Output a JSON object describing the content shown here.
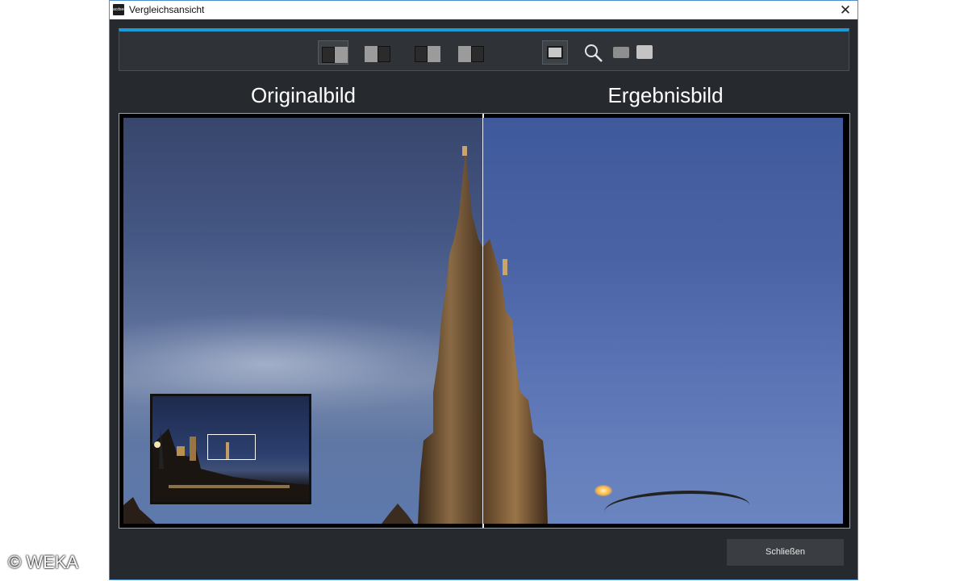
{
  "window": {
    "title": "Vergleichsansicht",
    "app_icon_text": "acdsee",
    "close_glyph": "✕"
  },
  "toolbar": {
    "accent_color": "#1c9ad6",
    "buttons": [
      {
        "icon": "split-view-vertical-icon",
        "active": true
      },
      {
        "icon": "split-view-left-icon",
        "active": false
      },
      {
        "icon": "side-by-side-dark-left-icon",
        "active": false
      },
      {
        "icon": "side-by-side-light-left-icon",
        "active": false
      },
      {
        "icon": "single-view-icon",
        "active": true
      },
      {
        "icon": "zoom-icon",
        "active": false
      },
      {
        "icon": "fit-to-window-icon",
        "active": false
      },
      {
        "icon": "actual-size-icon",
        "active": false
      }
    ]
  },
  "headings": {
    "left": "Originalbild",
    "right": "Ergebnisbild"
  },
  "footer": {
    "close_label": "Schließen"
  },
  "watermark": "© WEKA"
}
